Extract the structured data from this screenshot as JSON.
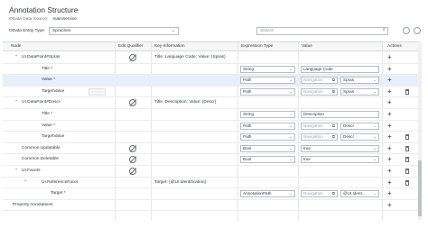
{
  "page": {
    "title": "Annotation Structure",
    "data_source_label": "OData Data Source:",
    "data_source_value": "mainService",
    "entity_type_label": "OData Entity Type:",
    "entity_type_value": "Sprachen",
    "search_placeholder": "Search"
  },
  "table": {
    "headers": [
      "Node",
      "Edit Qualifier",
      "Key Information",
      "Expression Type",
      "Value",
      "Actions"
    ],
    "rows": [
      {
        "node": "UI.DataPoint#Spras",
        "indent": 1,
        "expander": "⌄",
        "qualifier": true,
        "key": "Title: Language Code; Value: {Spras}",
        "expr": "",
        "value": "",
        "value2": "",
        "trash": false,
        "selected": false
      },
      {
        "node": "Title *",
        "indent": 2,
        "expander": "",
        "qualifier": false,
        "key": "",
        "expr": "String",
        "value": "Language Code",
        "value2": "",
        "trash": false,
        "selected": false
      },
      {
        "node": "Value *",
        "indent": 2,
        "expander": "",
        "qualifier": false,
        "key": "",
        "expr": "Path",
        "value": "Navigation",
        "value2": "Spras",
        "trash": false,
        "selected": true
      },
      {
        "node": "TargetValue",
        "indent": 2,
        "expander": "",
        "qualifier": false,
        "key": "",
        "expr": "Path",
        "value": "Navigation",
        "value2": "Spras",
        "trash": true,
        "selected": false
      },
      {
        "node": "UI.DataPoint#Descr",
        "indent": 1,
        "expander": "⌄",
        "qualifier": true,
        "key": "Title: Description; Value: {Descr}",
        "expr": "",
        "value": "",
        "value2": "",
        "trash": false,
        "selected": false
      },
      {
        "node": "Title *",
        "indent": 2,
        "expander": "",
        "qualifier": false,
        "key": "",
        "expr": "String",
        "value": "Description",
        "value2": "",
        "trash": false,
        "selected": false
      },
      {
        "node": "Value *",
        "indent": 2,
        "expander": "",
        "qualifier": false,
        "key": "",
        "expr": "Path",
        "value": "Navigation",
        "value2": "Descr",
        "trash": false,
        "selected": false
      },
      {
        "node": "TargetValue",
        "indent": 2,
        "expander": "",
        "qualifier": false,
        "key": "",
        "expr": "Path",
        "value": "Navigation",
        "value2": "Descr",
        "trash": true,
        "selected": false
      },
      {
        "node": "Common.Updatable",
        "indent": 1,
        "expander": "",
        "qualifier": true,
        "key": "",
        "expr": "Bool",
        "value": "true",
        "value2": "",
        "trash": true,
        "selected": false
      },
      {
        "node": "Common.Deletable",
        "indent": 1,
        "expander": "",
        "qualifier": true,
        "key": "",
        "expr": "Bool",
        "value": "true",
        "value2": "",
        "trash": true,
        "selected": false
      },
      {
        "node": "UI.Facets",
        "indent": 1,
        "expander": "⌄",
        "qualifier": true,
        "key": "",
        "expr": "",
        "value": "",
        "value2": "",
        "trash": true,
        "selected": false
      },
      {
        "node": "UI.ReferenceFacet",
        "indent": 2,
        "expander": "⌄",
        "qualifier": false,
        "key": "Target: {@UI.Identification}",
        "expr": "",
        "value": "",
        "value2": "",
        "trash": true,
        "selected": false
      },
      {
        "node": "Target *",
        "indent": 3,
        "expander": "",
        "qualifier": false,
        "key": "",
        "expr": "AnnotationPath",
        "value": "Navigation",
        "value2": "@UI.Ident...",
        "trash": false,
        "selected": false
      },
      {
        "node": "Property Annotations",
        "indent": 0,
        "expander": "",
        "qualifier": false,
        "key": "",
        "expr": "",
        "value": "",
        "value2": "",
        "trash": false,
        "selected": false
      }
    ]
  }
}
